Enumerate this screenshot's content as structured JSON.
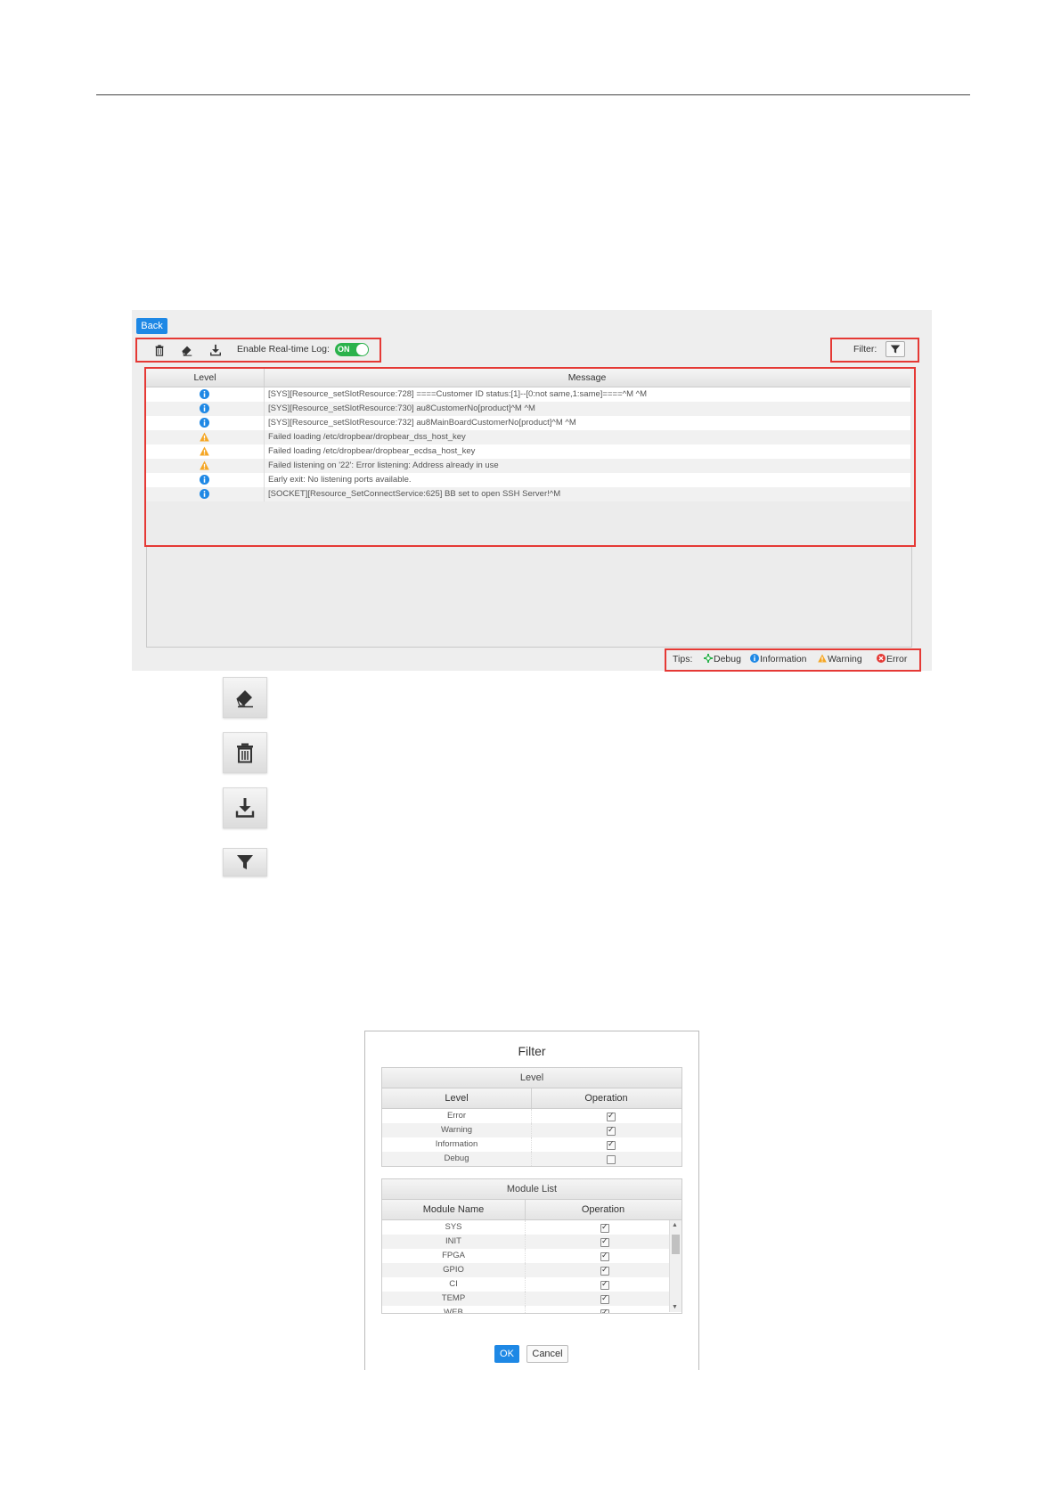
{
  "log_view": {
    "back_label": "Back",
    "toolbar": {
      "realtime_label": "Enable Real-time Log:",
      "toggle_label": "ON",
      "filter_label": "Filter:"
    },
    "table": {
      "headers": {
        "level": "Level",
        "message": "Message"
      },
      "rows": [
        {
          "level": "information",
          "message": "[SYS][Resource_setSlotResource:728] ====Customer ID status:[1]--[0:not same,1:same]====^M ^M"
        },
        {
          "level": "information",
          "message": "[SYS][Resource_setSlotResource:730] au8CustomerNo[product]^M ^M"
        },
        {
          "level": "information",
          "message": "[SYS][Resource_setSlotResource:732] au8MainBoardCustomerNo[product]^M ^M"
        },
        {
          "level": "warning",
          "message": "Failed loading /etc/dropbear/dropbear_dss_host_key"
        },
        {
          "level": "warning",
          "message": "Failed loading /etc/dropbear/dropbear_ecdsa_host_key"
        },
        {
          "level": "warning",
          "message": "Failed listening on '22': Error listening: Address already in use"
        },
        {
          "level": "information",
          "message": "Early exit: No listening ports available."
        },
        {
          "level": "information",
          "message": "[SOCKET][Resource_SetConnectService:625] BB set to open SSH Server!^M"
        }
      ]
    },
    "tips": {
      "label": "Tips:",
      "debug": "Debug",
      "information": "Information",
      "warning": "Warning",
      "error": "Error"
    }
  },
  "icon_legend": [
    "eraser-icon",
    "trash-icon",
    "download-icon",
    "filter-icon"
  ],
  "filter_dialog": {
    "title": "Filter",
    "level_panel": {
      "title": "Level",
      "col_level": "Level",
      "col_operation": "Operation",
      "rows": [
        {
          "name": "Error",
          "checked": true
        },
        {
          "name": "Warning",
          "checked": true
        },
        {
          "name": "Information",
          "checked": true
        },
        {
          "name": "Debug",
          "checked": false
        }
      ]
    },
    "module_panel": {
      "title": "Module List",
      "col_module": "Module Name",
      "col_operation": "Operation",
      "rows": [
        {
          "name": "SYS",
          "checked": true
        },
        {
          "name": "INIT",
          "checked": true
        },
        {
          "name": "FPGA",
          "checked": true
        },
        {
          "name": "GPIO",
          "checked": true
        },
        {
          "name": "CI",
          "checked": true
        },
        {
          "name": "TEMP",
          "checked": true
        },
        {
          "name": "WEB",
          "checked": true
        }
      ]
    },
    "ok_label": "OK",
    "cancel_label": "Cancel"
  },
  "colors": {
    "accent": "#1e88e5",
    "toggle_on": "#2bb24c",
    "highlight": "#e53935",
    "info": "#1e88e5",
    "warning": "#f5a623",
    "debug": "#2bb24c",
    "error": "#e53935"
  }
}
